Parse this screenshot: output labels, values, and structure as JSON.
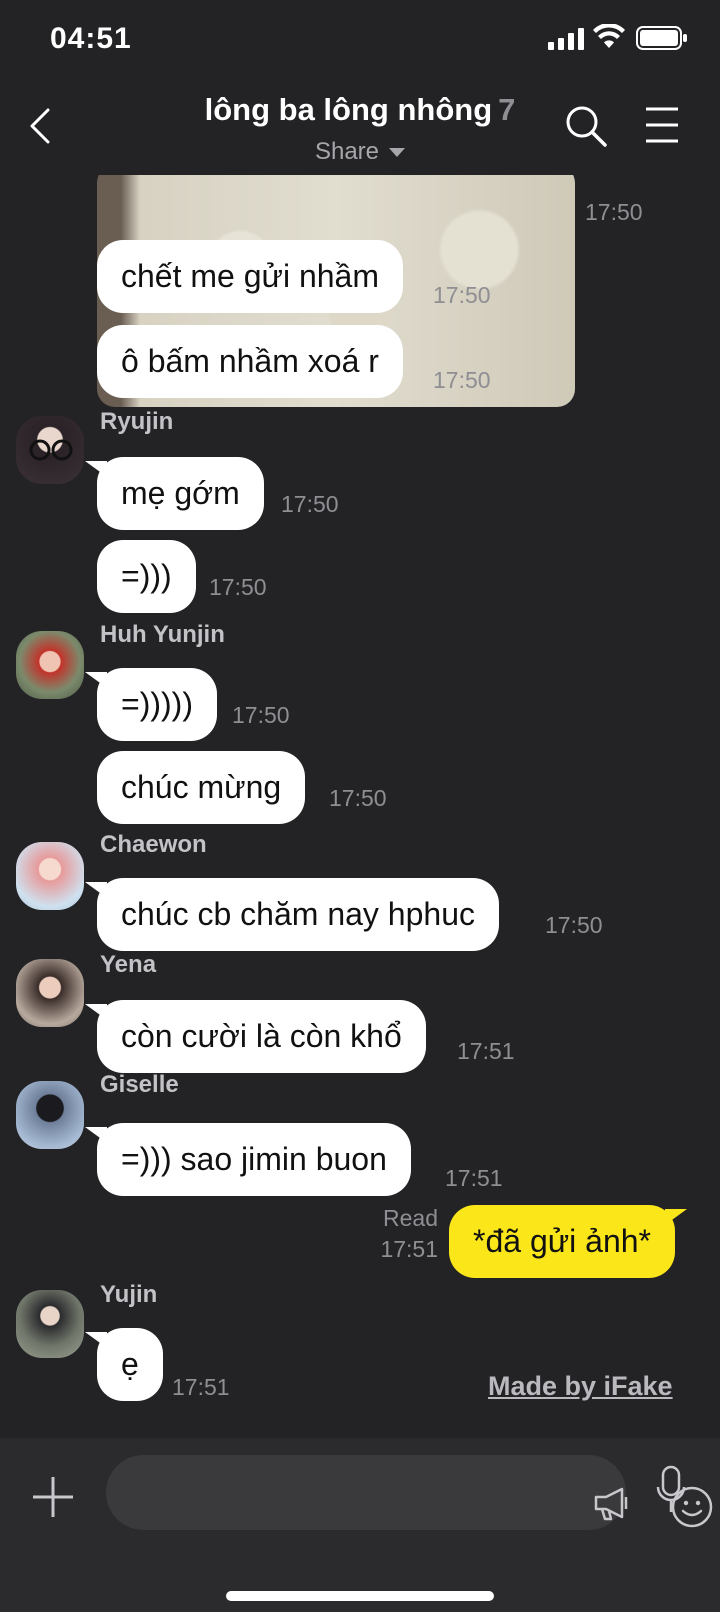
{
  "status": {
    "time": "04:51"
  },
  "header": {
    "title": "lông ba lông nhông",
    "member_count": "7",
    "subtitle": "Share"
  },
  "messages": {
    "photo_time": "17:50",
    "m1": {
      "text": "chết me gửi nhầm",
      "time": "17:50"
    },
    "m2": {
      "text": "ô bấm nhầm xoá r",
      "time": "17:50"
    },
    "ryujin": {
      "name": "Ryujin",
      "m1": "mẹ gớm",
      "t1": "17:50",
      "m2": "=)))",
      "t2": "17:50"
    },
    "huh": {
      "name": "Huh Yunjin",
      "m1": "=)))))",
      "t1": "17:50",
      "m2": "chúc mừng",
      "t2": "17:50"
    },
    "chaewon": {
      "name": "Chaewon",
      "m1": "chúc cb chăm nay hphuc",
      "t1": "17:50"
    },
    "yena": {
      "name": "Yena",
      "m1": "còn cười là còn khổ",
      "t1": "17:51"
    },
    "giselle": {
      "name": "Giselle",
      "m1": "=))) sao jimin buon",
      "t1": "17:51"
    },
    "mine": {
      "read": "Read",
      "time": "17:51",
      "text": "*đã gửi ảnh*"
    },
    "yujin": {
      "name": "Yujin",
      "m1": "ẹ",
      "t1": "17:51"
    }
  },
  "watermark": "Made by iFake",
  "colors": {
    "background": "#232326",
    "bubble_other": "#ffffff",
    "bubble_mine": "#fbe619",
    "meta": "#8e8e93"
  }
}
